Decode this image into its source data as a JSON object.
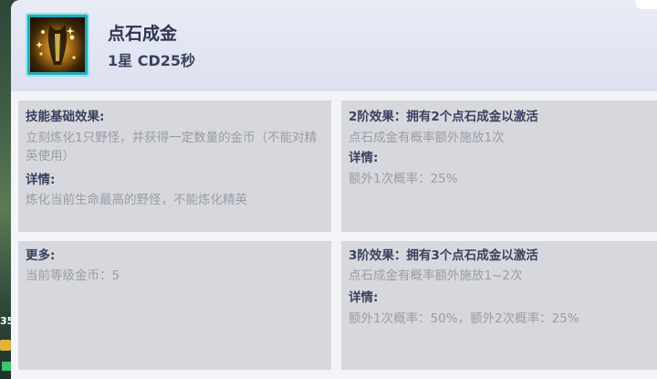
{
  "skill": {
    "name": "点石成金",
    "meta": "1星 CD25秒"
  },
  "left_edge": {
    "number": "35"
  },
  "cards": {
    "base": {
      "heading": "技能基础效果:",
      "effect": "立刻炼化1只野怪，并获得一定数量的金币（不能对精英使用）",
      "details_heading": "详情:",
      "details": "炼化当前生命最高的野怪，不能炼化精英"
    },
    "tier2": {
      "heading": "2阶效果：拥有2个点石成金以激活",
      "effect": "点石成金有概率额外施放1次",
      "details_heading": "详情:",
      "details": "额外1次概率：25%"
    },
    "more": {
      "heading": "更多:",
      "value": "当前等级金币：5"
    },
    "tier3": {
      "heading": "3阶效果：拥有3个点石成金以激活",
      "effect": "点石成金有概率额外施放1~2次",
      "details_heading": "详情:",
      "details": "额外1次概率：50%，额外2次概率：25%"
    }
  },
  "colors": {
    "panel": "#f3f4f8",
    "header": "#dde1ef",
    "card": "#d7d8dd",
    "heading_text": "#3a4160",
    "body_text": "#9a9ca6",
    "icon_border": "#2aa9b8"
  },
  "icons": {
    "skill_icon": "golden-hand-spell-icon"
  }
}
